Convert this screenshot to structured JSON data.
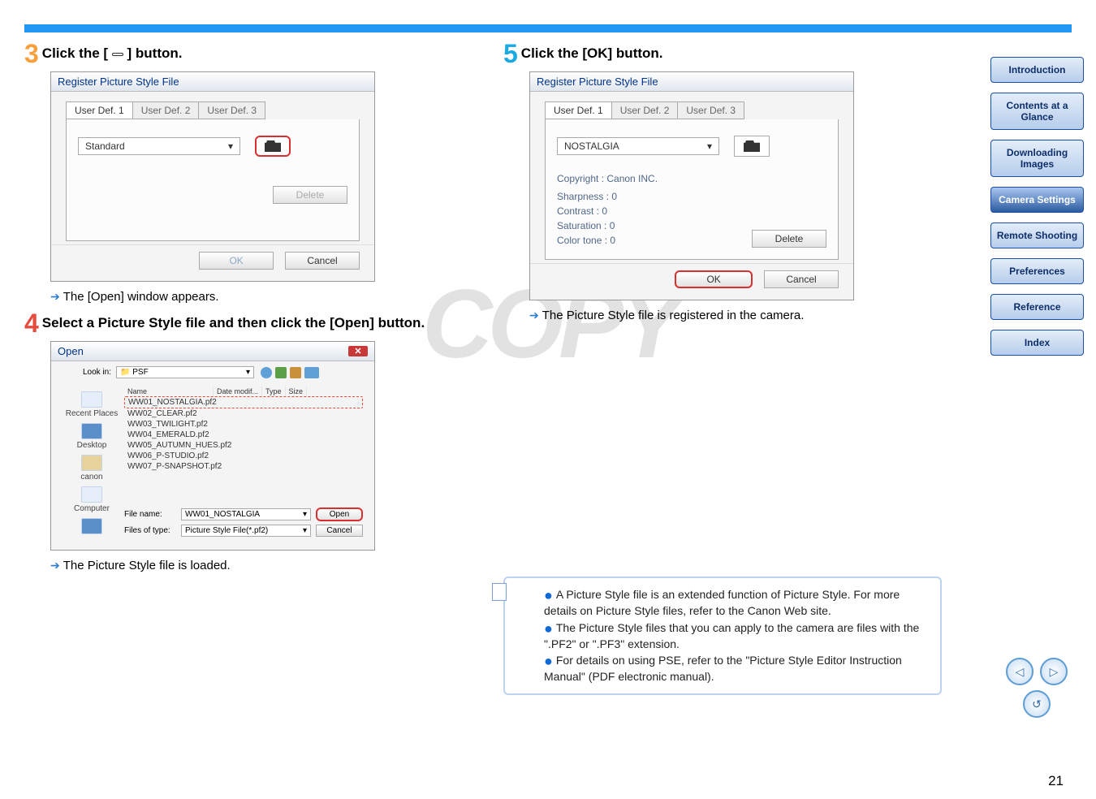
{
  "sidebar": {
    "items": [
      "Introduction",
      "Contents at a Glance",
      "Downloading Images",
      "Camera Settings",
      "Remote Shooting",
      "Preferences",
      "Reference",
      "Index"
    ]
  },
  "page_number": "21",
  "watermark": "COPY",
  "step3": {
    "num": "3",
    "text_a": "Click the [",
    "text_b": "] button.",
    "dialog_title": "Register Picture Style File",
    "tabs": [
      "User Def. 1",
      "User Def. 2",
      "User Def. 3"
    ],
    "dropdown": "Standard",
    "delete": "Delete",
    "ok": "OK",
    "cancel": "Cancel",
    "result": "The [Open] window appears."
  },
  "step4": {
    "num": "4",
    "text": "Select a Picture Style file and then click the [Open] button.",
    "open_title": "Open",
    "lookin_label": "Look in:",
    "lookin_value": "PSF",
    "headers": [
      "Name",
      "Date modif...",
      "Type",
      "Size"
    ],
    "files": [
      "WW01_NOSTALGIA.pf2",
      "WW02_CLEAR.pf2",
      "WW03_TWILIGHT.pf2",
      "WW04_EMERALD.pf2",
      "WW05_AUTUMN_HUES.pf2",
      "WW06_P-STUDIO.pf2",
      "WW07_P-SNAPSHOT.pf2"
    ],
    "places": [
      "Recent Places",
      "Desktop",
      "canon",
      "Computer"
    ],
    "filename_label": "File name:",
    "filename_value": "WW01_NOSTALGIA",
    "filetype_label": "Files of type:",
    "filetype_value": "Picture Style File(*.pf2)",
    "open_btn": "Open",
    "cancel_btn": "Cancel",
    "result": "The Picture Style file is loaded."
  },
  "step5": {
    "num": "5",
    "text": "Click the [OK] button.",
    "dialog_title": "Register Picture Style File",
    "tabs": [
      "User Def. 1",
      "User Def. 2",
      "User Def. 3"
    ],
    "dropdown": "NOSTALGIA",
    "copyright": "Copyright : Canon INC.",
    "params": [
      "Sharpness : 0",
      "Contrast : 0",
      "Saturation : 0",
      "Color tone : 0"
    ],
    "delete": "Delete",
    "ok": "OK",
    "cancel": "Cancel",
    "result": "The Picture Style file is registered in the camera."
  },
  "info": {
    "l1": "A Picture Style file is an extended function of Picture Style. For more details on Picture Style files, refer to the Canon Web site.",
    "l2": "The Picture Style files that you can apply to the camera are files with the \".PF2\" or \".PF3\" extension.",
    "l3": "For details on using PSE, refer to the \"Picture Style Editor Instruction Manual\" (PDF electronic manual)."
  }
}
